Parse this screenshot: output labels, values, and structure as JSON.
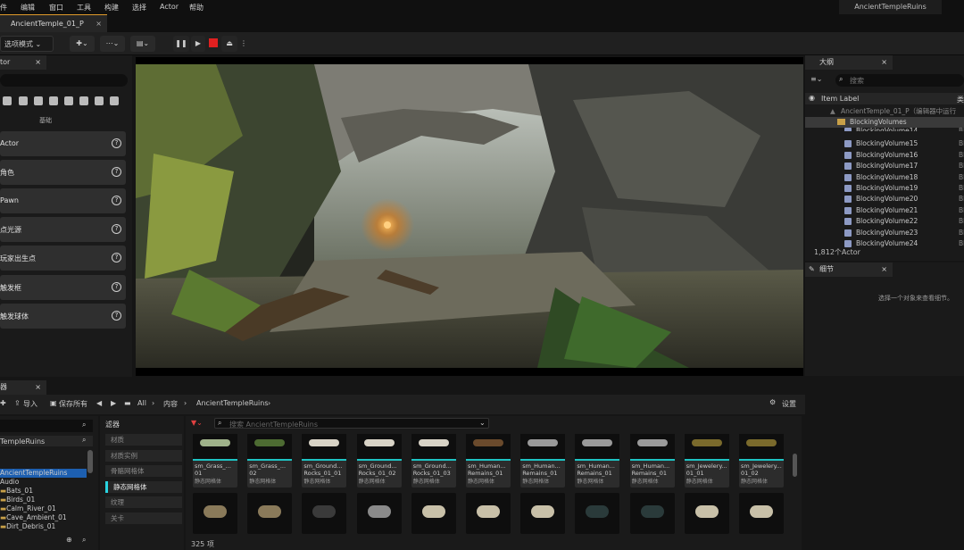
{
  "menu": [
    "件",
    "编辑",
    "窗口",
    "工具",
    "构建",
    "选择",
    "Actor",
    "帮助"
  ],
  "project_name": "AncientTempleRuins",
  "level_tab": "AncientTemple_01_P",
  "toolbar": {
    "mode": "选项模式"
  },
  "left_panel": {
    "tab": "tor",
    "basic_label": "基础",
    "items": [
      "Actor",
      "角色",
      "Pawn",
      "点光源",
      "玩家出生点",
      "触发框",
      "触发球体"
    ]
  },
  "outliner": {
    "tab": "大纲",
    "search_placeholder": "搜索",
    "column_label": "Item Label",
    "column_type": "类",
    "root": "AncientTemple_01_P（编辑器中运行",
    "folder": "BlockingVolumes",
    "rows": [
      "BlockingVolume14",
      "BlockingVolume15",
      "BlockingVolume16",
      "BlockingVolume17",
      "BlockingVolume18",
      "BlockingVolume19",
      "BlockingVolume20",
      "BlockingVolume21",
      "BlockingVolume22",
      "BlockingVolume23",
      "BlockingVolume24"
    ],
    "row_type": "Bl",
    "count": "1,812个Actor"
  },
  "details": {
    "tab": "细节",
    "empty": "选择一个对象来查看细节。"
  },
  "content_browser": {
    "tab": "器",
    "import": "导入",
    "save_all": "保存所有",
    "path": [
      "All",
      "内容",
      "AncientTempleRuins"
    ],
    "settings": "设置",
    "filter_title": "滤器",
    "search_placeholder": "搜索 AncientTempleRuins",
    "tree_root": "TempleRuins",
    "tree": [
      "AncientTempleRuins",
      "Audio",
      "Bats_01",
      "Birds_01",
      "Calm_River_01",
      "Cave_Ambient_01",
      "Dirt_Debris_01"
    ],
    "filters": [
      "材质",
      "材质实例",
      "骨骼网格体",
      "静态网格体",
      "纹理",
      "关卡"
    ],
    "active_filter": "静态网格体",
    "assets": [
      {
        "name": "sm_Grass_...",
        "num": "01",
        "type": "静态网格体"
      },
      {
        "name": "sm_Grass_...",
        "num": "02",
        "type": "静态网格体"
      },
      {
        "name": "sm_Ground...",
        "num": "Rocks_01_01",
        "type": "静态网格体"
      },
      {
        "name": "sm_Ground...",
        "num": "Rocks_01_02",
        "type": "静态网格体"
      },
      {
        "name": "sm_Ground...",
        "num": "Rocks_01_03",
        "type": "静态网格体"
      },
      {
        "name": "sm_Human...",
        "num": "Remains_01",
        "type": "静态网格体"
      },
      {
        "name": "sm_Human...",
        "num": "Remains_01",
        "type": "静态网格体"
      },
      {
        "name": "sm_Human...",
        "num": "Remains_01",
        "type": "静态网格体"
      },
      {
        "name": "sm_Human...",
        "num": "Remains_01",
        "type": "静态网格体"
      },
      {
        "name": "sm_Jewelery...",
        "num": "01_01",
        "type": "静态网格体"
      },
      {
        "name": "sm_Jewelery...",
        "num": "01_02",
        "type": "静态网格体"
      }
    ],
    "item_count": "325 项"
  }
}
